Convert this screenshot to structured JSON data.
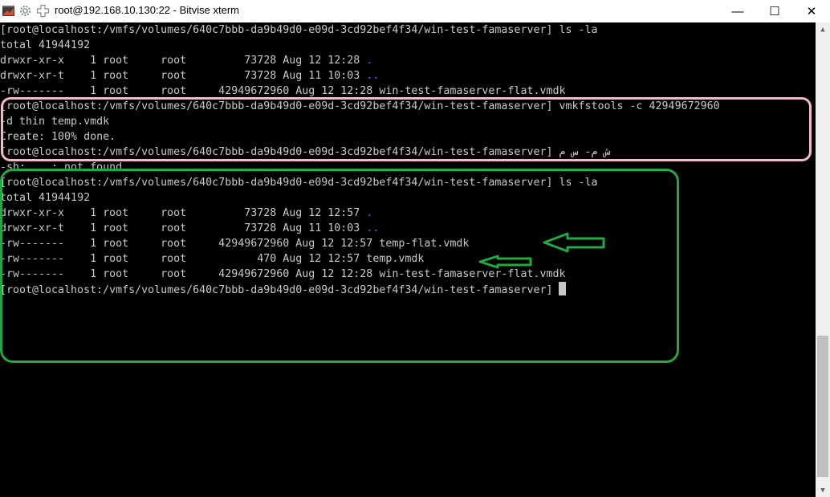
{
  "window": {
    "title": "root@192.168.10.130:22 - Bitvise xterm",
    "controls": {
      "minimize": "—",
      "maximize": "☐",
      "close": "✕"
    }
  },
  "terminal": {
    "lines": [
      {
        "text": "[root@localhost:/vmfs/volumes/640c7bbb-da9b49d0-e09d-3cd92bef4f34/win-test-famaserver] ls -la",
        "dot": ""
      },
      {
        "text": "total 41944192",
        "dot": ""
      },
      {
        "text": "drwxr-xr-x    1 root     root         73728 Aug 12 12:28 ",
        "dot": "."
      },
      {
        "text": "drwxr-xr-t    1 root     root         73728 Aug 11 10:03 ",
        "dot": ".."
      },
      {
        "text": "-rw-------    1 root     root     42949672960 Aug 12 12:28 win-test-famaserver-flat.vmdk",
        "dot": ""
      },
      {
        "text": "[root@localhost:/vmfs/volumes/640c7bbb-da9b49d0-e09d-3cd92bef4f34/win-test-famaserver] vmkfstools -c 42949672960",
        "dot": ""
      },
      {
        "text": "-d thin temp.vmdk",
        "dot": ""
      },
      {
        "text": "Create: 100% done.",
        "dot": ""
      },
      {
        "text": "[root@localhost:/vmfs/volumes/640c7bbb-da9b49d0-e09d-3cd92bef4f34/win-test-famaserver] ش م- س م",
        "dot": ""
      },
      {
        "text": "-sh: ...: not found",
        "dot": ""
      },
      {
        "text": "[root@localhost:/vmfs/volumes/640c7bbb-da9b49d0-e09d-3cd92bef4f34/win-test-famaserver] ls -la",
        "dot": ""
      },
      {
        "text": "total 41944192",
        "dot": ""
      },
      {
        "text": "drwxr-xr-x    1 root     root         73728 Aug 12 12:57 ",
        "dot": "."
      },
      {
        "text": "drwxr-xr-t    1 root     root         73728 Aug 11 10:03 ",
        "dot": ".."
      },
      {
        "text": "-rw-------    1 root     root     42949672960 Aug 12 12:57 temp-flat.vmdk",
        "dot": ""
      },
      {
        "text": "-rw-------    1 root     root           470 Aug 12 12:57 temp.vmdk",
        "dot": ""
      },
      {
        "text": "-rw-------    1 root     root     42949672960 Aug 12 12:28 win-test-famaserver-flat.vmdk",
        "dot": ""
      },
      {
        "text": "[root@localhost:/vmfs/volumes/640c7bbb-da9b49d0-e09d-3cd92bef4f34/win-test-famaserver] ",
        "dot": "",
        "cursor": true
      }
    ]
  },
  "colors": {
    "background": "#000000",
    "text": "#c8c8c8",
    "dir_dot": "#3b78ff",
    "pink_annotation": "#f4b8c8",
    "green_annotation": "#22a845"
  },
  "annotations": {
    "pink_box": "vmkfstools command block",
    "green_box": "ls -la result block",
    "arrows": [
      "temp-flat.vmdk",
      "temp.vmdk"
    ]
  }
}
